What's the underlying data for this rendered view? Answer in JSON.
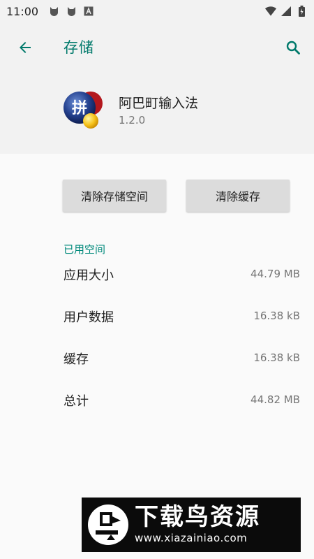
{
  "status_bar": {
    "time": "11:00",
    "left_icons": [
      "cat-notification-icon",
      "cat-notification-icon",
      "a-box-icon"
    ],
    "right_icons": [
      "wifi-icon",
      "signal-icon",
      "battery-icon"
    ]
  },
  "toolbar": {
    "title": "存储",
    "back_icon": "arrow-left-icon",
    "search_icon": "search-icon"
  },
  "app": {
    "name": "阿巴町输入法",
    "version": "1.2.0",
    "icon_glyph": "拼"
  },
  "actions": {
    "clear_storage": "清除存储空间",
    "clear_cache": "清除缓存"
  },
  "usage": {
    "section_title": "已用空间",
    "rows": [
      {
        "label": "应用大小",
        "value": "44.79 MB"
      },
      {
        "label": "用户数据",
        "value": "16.38 kB"
      },
      {
        "label": "缓存",
        "value": "16.38 kB"
      },
      {
        "label": "总计",
        "value": "44.82 MB"
      }
    ]
  },
  "watermark": {
    "title": "下载鸟资源",
    "url": "www.xiazainiao.com"
  },
  "colors": {
    "accent": "#00796b",
    "section": "#00897b",
    "header_bg": "#f2f2f2",
    "button_bg": "#dcdcdc"
  }
}
